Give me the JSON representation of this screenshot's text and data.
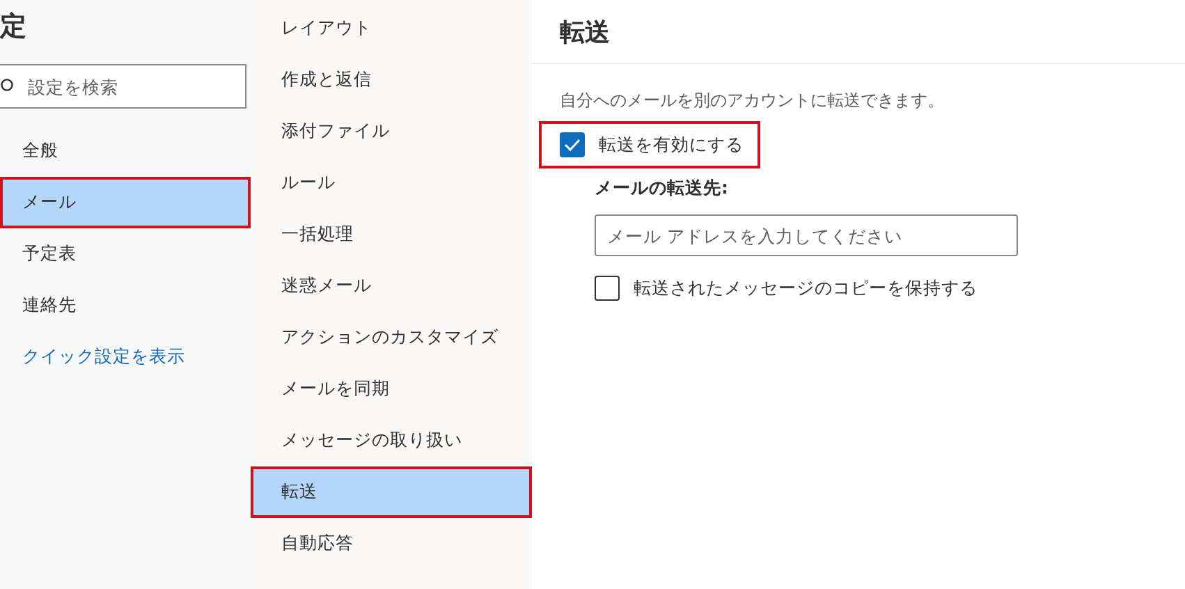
{
  "sidebar": {
    "title": "定",
    "search": {
      "placeholder": "設定を検索"
    },
    "items": [
      {
        "label": "全般",
        "kind": "item",
        "selected": false,
        "highlighted": false
      },
      {
        "label": "メール",
        "kind": "item",
        "selected": true,
        "highlighted": true
      },
      {
        "label": "予定表",
        "kind": "item",
        "selected": false,
        "highlighted": false
      },
      {
        "label": "連絡先",
        "kind": "item",
        "selected": false,
        "highlighted": false
      },
      {
        "label": "クイック設定を表示",
        "kind": "link",
        "selected": false,
        "highlighted": false
      }
    ]
  },
  "submenu": {
    "items": [
      {
        "label": "レイアウト",
        "selected": false,
        "highlighted": false
      },
      {
        "label": "作成と返信",
        "selected": false,
        "highlighted": false
      },
      {
        "label": "添付ファイル",
        "selected": false,
        "highlighted": false
      },
      {
        "label": "ルール",
        "selected": false,
        "highlighted": false
      },
      {
        "label": "一括処理",
        "selected": false,
        "highlighted": false
      },
      {
        "label": "迷惑メール",
        "selected": false,
        "highlighted": false
      },
      {
        "label": "アクションのカスタマイズ",
        "selected": false,
        "highlighted": false
      },
      {
        "label": "メールを同期",
        "selected": false,
        "highlighted": false
      },
      {
        "label": "メッセージの取り扱い",
        "selected": false,
        "highlighted": false
      },
      {
        "label": "転送",
        "selected": true,
        "highlighted": true
      },
      {
        "label": "自動応答",
        "selected": false,
        "highlighted": false
      }
    ]
  },
  "content": {
    "title": "転送",
    "description": "自分へのメールを別のアカウントに転送できます。",
    "enable": {
      "label": "転送を有効にする",
      "checked": true,
      "highlighted": true
    },
    "address_label": "メールの転送先:",
    "address_field": {
      "placeholder": "メール アドレスを入力してください"
    },
    "keep_copy": {
      "label": "転送されたメッセージのコピーを保持する",
      "checked": false,
      "highlighted": false
    }
  }
}
